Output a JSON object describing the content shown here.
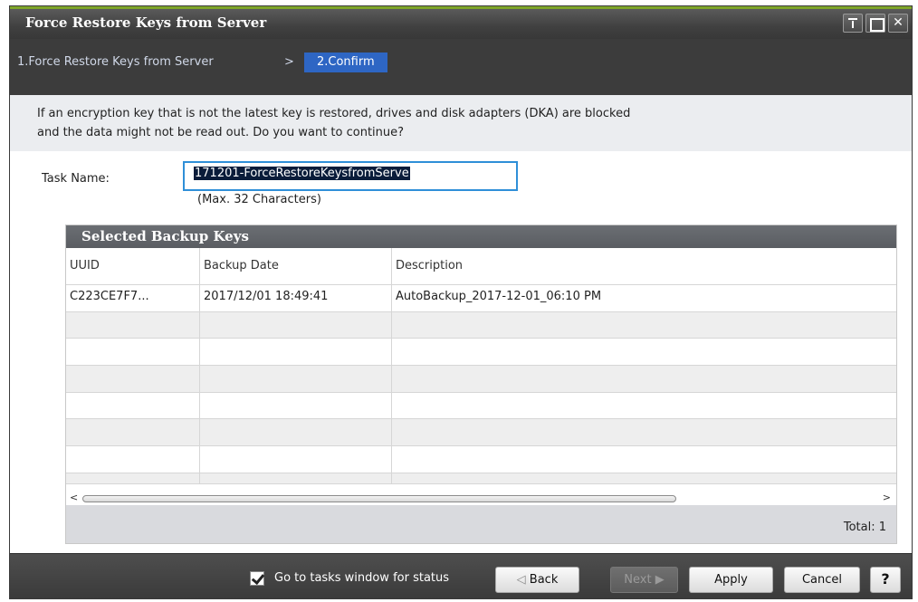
{
  "window": {
    "title": "Force Restore Keys from Server"
  },
  "wizard": {
    "step1": "1.Force Restore Keys from Server",
    "separator": ">",
    "step2": "2.Confirm"
  },
  "message": {
    "line1": "If an encryption key that is not the latest key is restored, drives and disk adapters (DKA) are blocked",
    "line2": "and the data might not be read out. Do you want to continue?"
  },
  "task": {
    "label": "Task Name:",
    "value": "171201-ForceRestoreKeysfromServe",
    "hint": "(Max. 32 Characters)"
  },
  "table": {
    "title": "Selected Backup Keys",
    "columns": [
      "UUID",
      "Backup Date",
      "Description"
    ],
    "rows": [
      [
        "C223CE7F7...",
        "2017/12/01 18:49:41",
        "AutoBackup_2017-12-01_06:10 PM"
      ]
    ],
    "total": "Total:  1"
  },
  "scrollbar": {
    "left_arrow": "<",
    "right_arrow": ">"
  },
  "footer": {
    "checkbox_label": "Go to tasks window for status",
    "back_label": "Back",
    "next_label": "Next",
    "apply_label": "Apply",
    "cancel_label": "Cancel",
    "help_label": "?"
  },
  "icons": {
    "pin": "pin-icon",
    "maximize": "maximize-icon",
    "close": "close-icon",
    "back_arrow": "chevron-left-icon",
    "next_arrow": "chevron-right-icon"
  },
  "colors": {
    "accent": "#7fa62a",
    "step_highlight": "#2e66c4",
    "input_focus": "#2f8fd8"
  }
}
